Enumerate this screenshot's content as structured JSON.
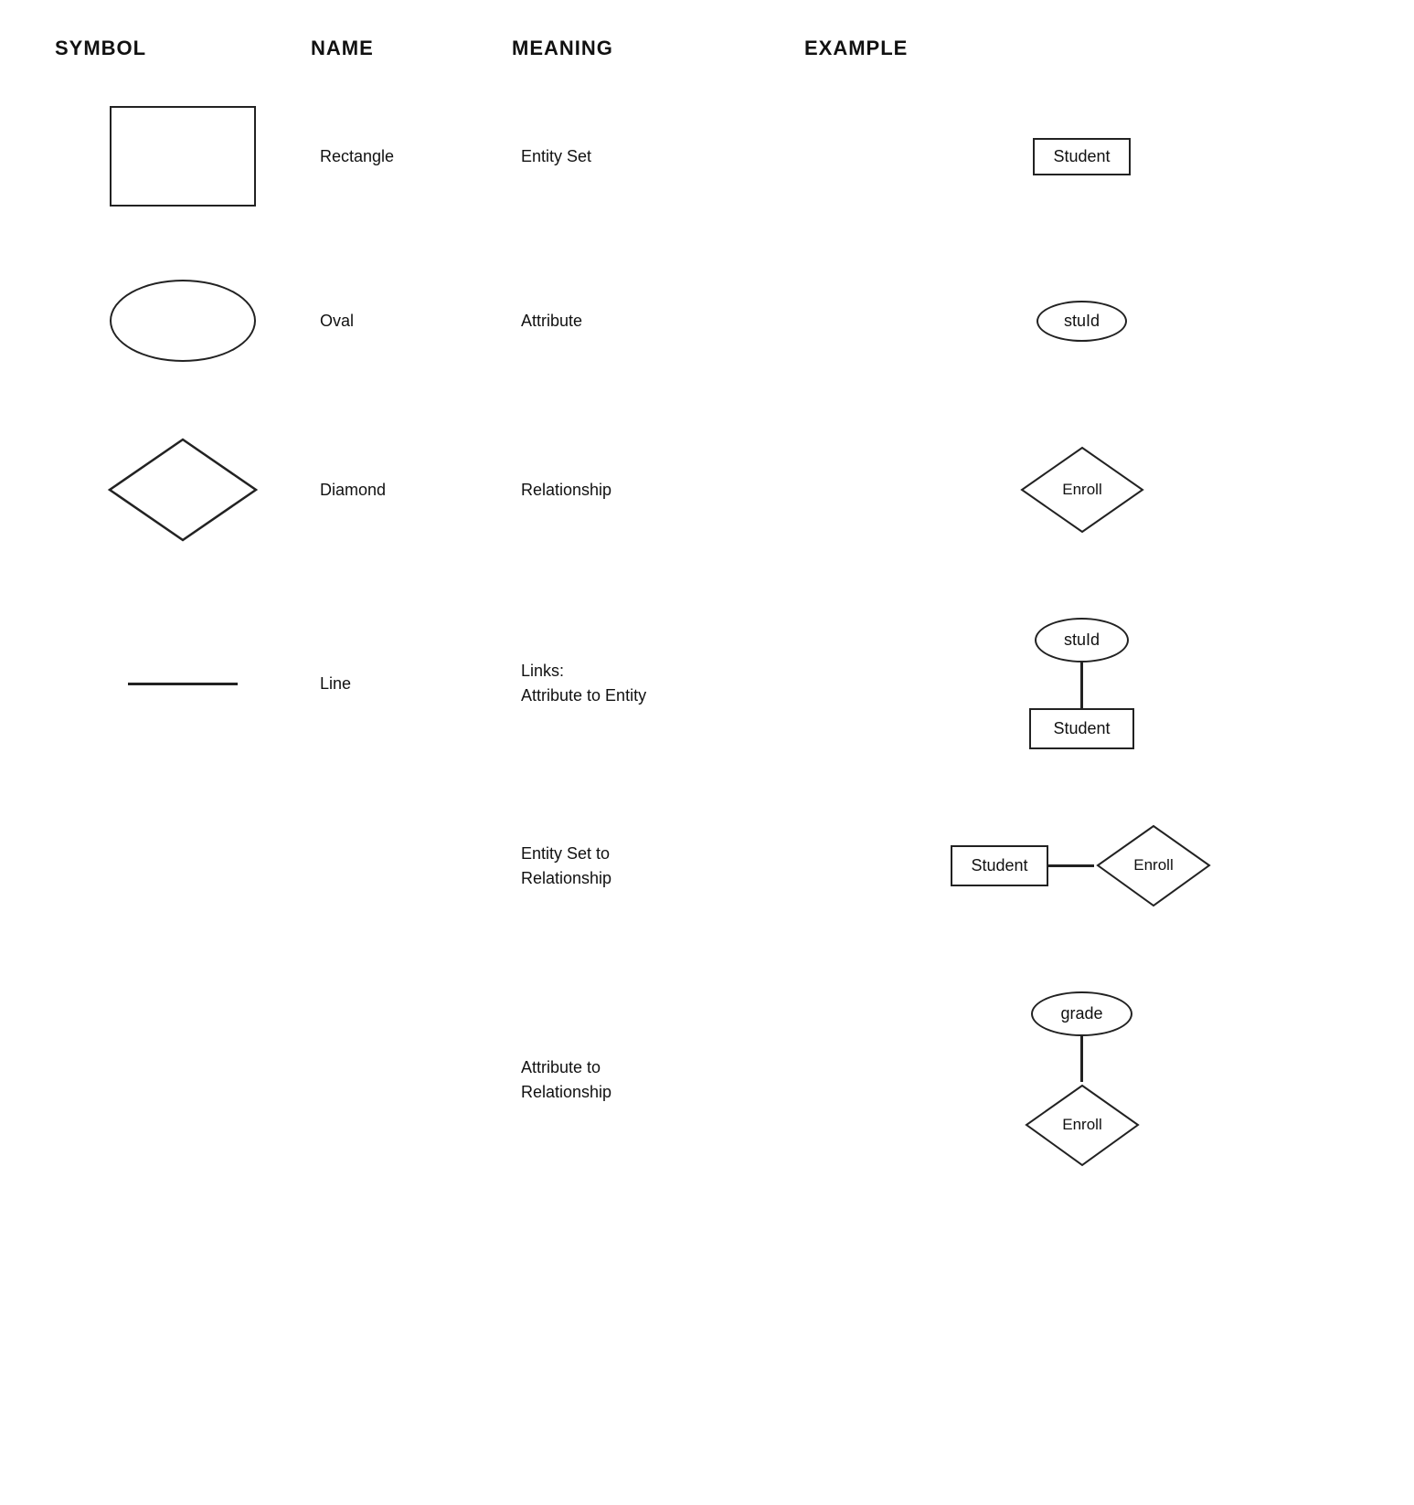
{
  "headers": {
    "symbol": "SYMBOL",
    "name": "NAME",
    "meaning": "MEANING",
    "example": "EXAMPLE"
  },
  "rows": [
    {
      "id": "rectangle",
      "name": "Rectangle",
      "meaning": "Entity Set",
      "example_label": "Student"
    },
    {
      "id": "oval",
      "name": "Oval",
      "meaning": "Attribute",
      "example_label": "stuId"
    },
    {
      "id": "diamond",
      "name": "Diamond",
      "meaning": "Relationship",
      "example_label": "Enroll"
    },
    {
      "id": "line",
      "name": "Line",
      "meaning_line1": "Links:",
      "meaning_line2": "Attribute to Entity",
      "example_oval": "stuId",
      "example_rect": "Student"
    }
  ],
  "special_rows": [
    {
      "id": "entity-set-to-relationship",
      "meaning_line1": "Entity Set to",
      "meaning_line2": "Relationship",
      "example_rect": "Student",
      "example_diamond": "Enroll"
    },
    {
      "id": "attribute-to-relationship",
      "meaning_line1": "Attribute to",
      "meaning_line2": "Relationship",
      "example_oval": "grade",
      "example_diamond": "Enroll"
    }
  ]
}
